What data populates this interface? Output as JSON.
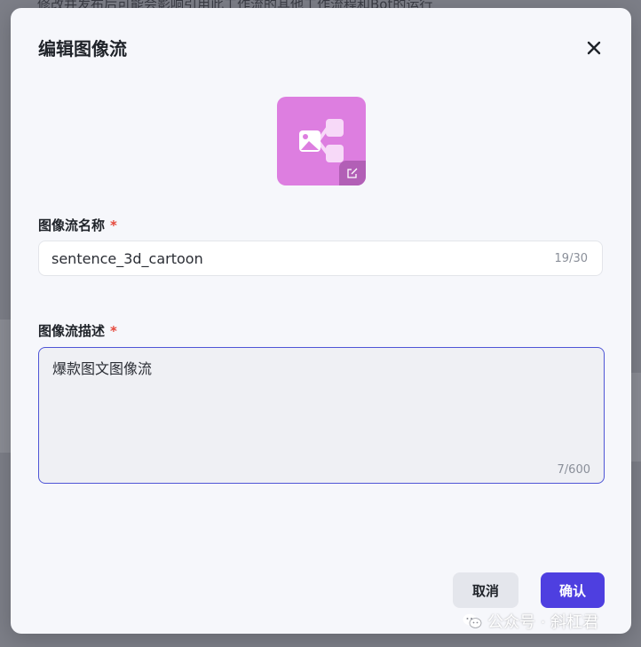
{
  "backdrop": {
    "text": "修改并发布后可能会影响引用此工作流的其他工作流程和Bot的运行"
  },
  "modal": {
    "title": "编辑图像流",
    "close_icon": "close-icon",
    "avatar": {
      "bg_color": "#dd7ee0",
      "icon": "image-flow-icon",
      "edit_icon": "edit-icon"
    },
    "name_field": {
      "label": "图像流名称",
      "required_mark": "*",
      "value": "sentence_3d_cartoon",
      "counter": "19/30"
    },
    "desc_field": {
      "label": "图像流描述",
      "required_mark": "*",
      "value": "爆款图文图像流",
      "counter": "7/600"
    },
    "cancel_label": "取消",
    "confirm_label": "确认",
    "accent_color": "#4e3fe0"
  },
  "watermark": {
    "icon": "wechat-icon",
    "text": "公众号 · 斜杠君"
  }
}
